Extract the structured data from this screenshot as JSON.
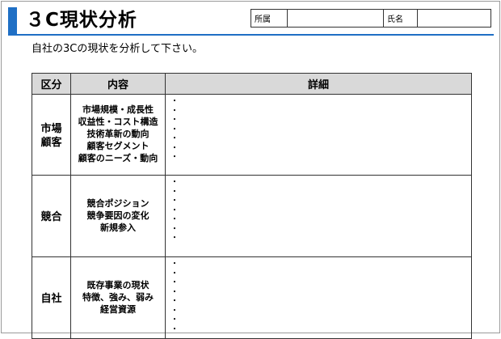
{
  "header": {
    "title": "３C現状分析",
    "affiliation_label": "所属",
    "affiliation_value": "",
    "name_label": "氏名",
    "name_value": ""
  },
  "instruction": "自社の3Cの現状を分析して下さい。",
  "table": {
    "columns": [
      "区分",
      "内容",
      "詳細"
    ],
    "rows": [
      {
        "category": [
          "市場",
          "顧客"
        ],
        "content": [
          "市場規模・成長性",
          "収益性・コスト構造",
          "技術革新の動向",
          "顧客セグメント",
          "顧客のニーズ・動向"
        ],
        "bullet_symbol": "・"
      },
      {
        "category": [
          "競合"
        ],
        "content": [
          "競合ポジション",
          "競争要因の変化",
          "新規参入"
        ],
        "bullet_symbol": "・"
      },
      {
        "category": [
          "自社"
        ],
        "content": [
          "既存事業の現状",
          "特徴、強み、弱み",
          "経営資源"
        ],
        "bullet_symbol": "・"
      }
    ]
  },
  "colors": {
    "accent_blue": "#1f6fc5",
    "header_fill": "#d9d9d9",
    "border": "#333333"
  }
}
